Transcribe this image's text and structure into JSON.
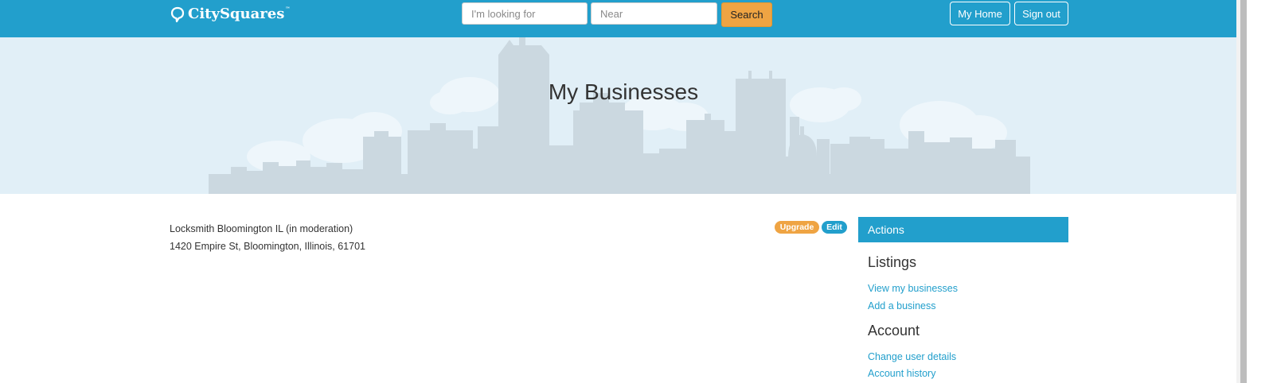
{
  "header": {
    "logo_text": "CitySquares",
    "logo_tm": "™",
    "search_what_placeholder": "I'm looking for",
    "search_where_placeholder": "Near",
    "search_button": "Search",
    "my_home": "My Home",
    "sign_out": "Sign out"
  },
  "hero": {
    "title": "My Businesses"
  },
  "listing": {
    "name": "Locksmith Bloomington IL (in moderation)",
    "address": "1420 Empire St, Bloomington, Illinois, 61701",
    "upgrade_label": "Upgrade",
    "edit_label": "Edit"
  },
  "sidebar": {
    "actions_title": "Actions",
    "listings_heading": "Listings",
    "listings_links": [
      "View my businesses",
      "Add a business"
    ],
    "account_heading": "Account",
    "account_links": [
      "Change user details",
      "Account history"
    ]
  },
  "colors": {
    "brand_blue": "#229fcc",
    "accent_orange": "#efa443",
    "hero_bg": "#e1eff7",
    "skyline": "#cbd8e0"
  }
}
